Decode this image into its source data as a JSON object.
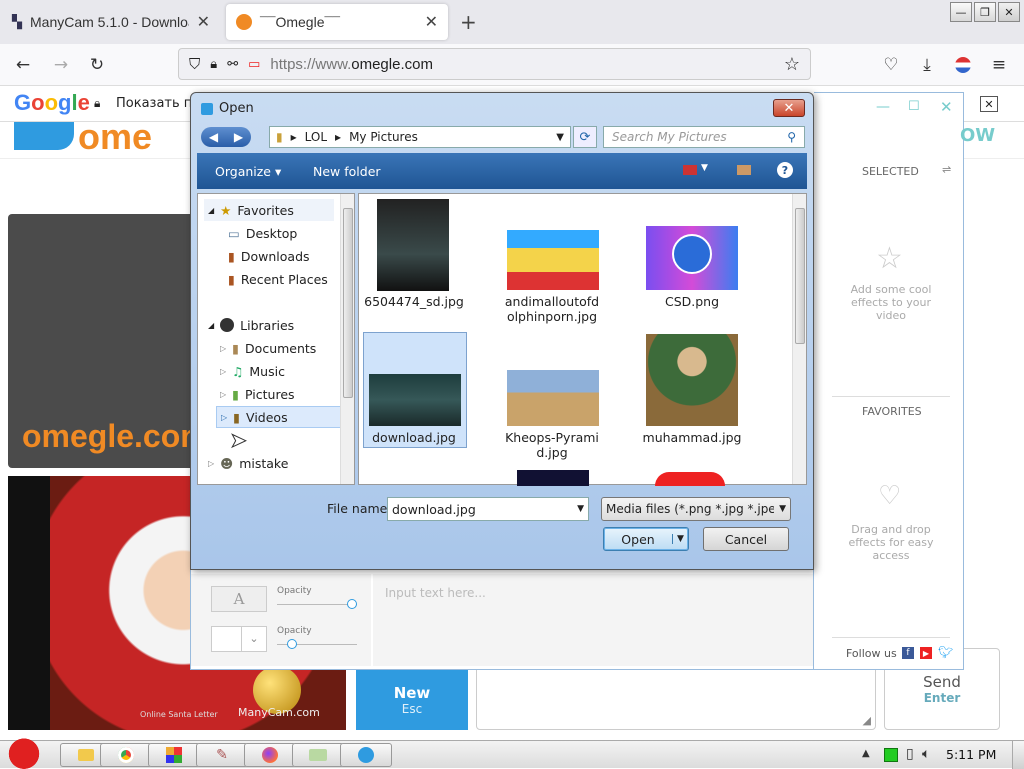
{
  "browser": {
    "tabs": [
      {
        "title": "ManyCam 5.1.0 - Download"
      },
      {
        "title": "¯¯Omegle¯¯"
      }
    ],
    "url_prefix": "https://www.",
    "url_domain": "omegle.com",
    "google_bar_text": "Показать пе"
  },
  "omegle": {
    "logo_text": "omegle.com",
    "watermark": "ManyCam.com",
    "new_button": "New",
    "new_key": "Esc",
    "send_button": "Send",
    "send_key": "Enter",
    "video_caption": "Online Santa Letter"
  },
  "dialog": {
    "title": "Open",
    "breadcrumb": [
      "LOL",
      "My Pictures"
    ],
    "search_placeholder": "Search My Pictures",
    "organize": "Organize",
    "new_folder": "New folder",
    "nav": {
      "favorites": "Favorites",
      "favorites_items": [
        "Desktop",
        "Downloads",
        "Recent Places"
      ],
      "libraries": "Libraries",
      "libraries_items": [
        "Documents",
        "Music",
        "Pictures",
        "Videos"
      ],
      "mistake": "mistake"
    },
    "files": [
      {
        "name": "6504474_sd.jpg"
      },
      {
        "name": "andimalloutofd olphinporn.jpg"
      },
      {
        "name": "CSD.png"
      },
      {
        "name": "download.jpg"
      },
      {
        "name": "Kheops-Pyrami d.jpg"
      },
      {
        "name": "muhammad.jpg"
      }
    ],
    "file_name_label": "File name:",
    "file_name_value": "download.jpg",
    "filter_value": "Media files (*.png *.jpg *.jpeg *",
    "open_button": "Open",
    "cancel_button": "Cancel"
  },
  "manycam": {
    "selected": "SELECTED",
    "add_effects": "Add some cool effects to your video",
    "favorites": "FAVORITES",
    "drag_drop": "Drag and drop effects for easy access",
    "follow_us": "Follow us",
    "text_placeholder": "Input text here...",
    "opacity1": "Opacity",
    "opacity2": "Opacity",
    "text_button": "A",
    "now_text": "OW"
  },
  "taskbar": {
    "clock": "5:11 PM"
  },
  "colors": {
    "omegle_orange": "#f08a24",
    "omegle_blue": "#2f9be0",
    "accent": "#1f5594"
  }
}
